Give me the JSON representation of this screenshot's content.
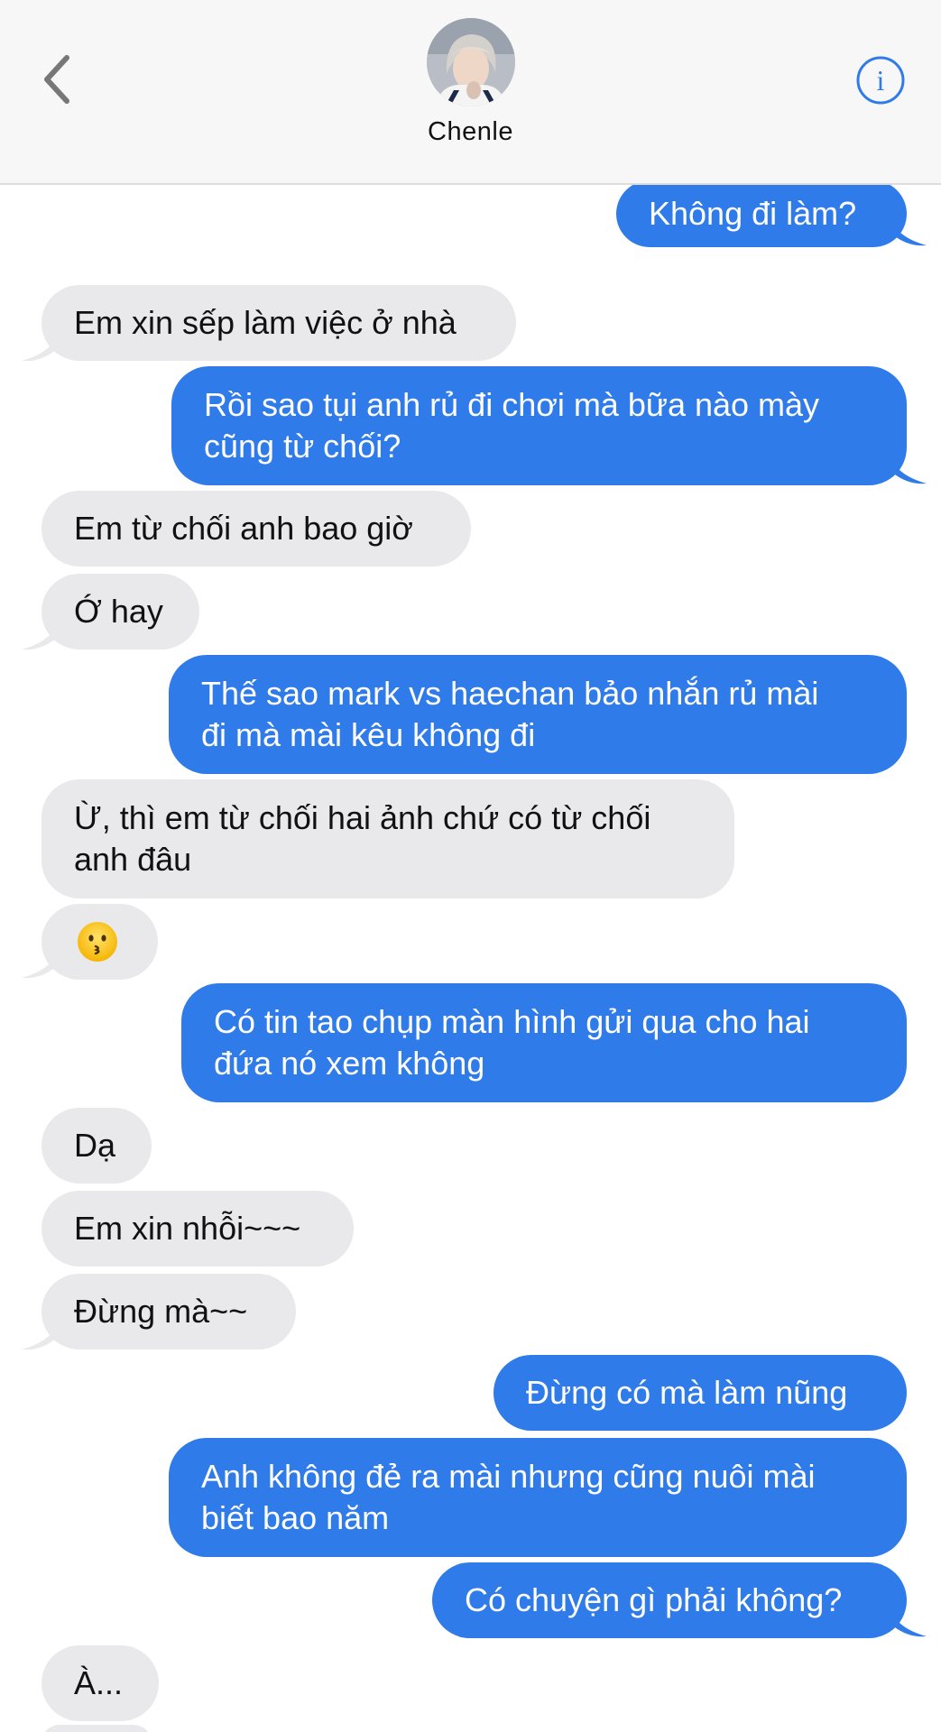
{
  "contact": {
    "name": "Chenle"
  },
  "messages": [
    {
      "side": "out",
      "text": "Không đi làm?"
    },
    {
      "side": "in",
      "text": "Em xin sếp làm việc ở nhà"
    },
    {
      "side": "out",
      "text": "Rồi sao tụi anh rủ đi chơi mà bữa nào mày\ncũng từ chối?"
    },
    {
      "side": "in",
      "text": "Em từ chối anh bao giờ"
    },
    {
      "side": "in",
      "text": "Ớ hay"
    },
    {
      "side": "out",
      "text": "Thế sao mark vs haechan bảo nhắn rủ mài\nđi mà mài kêu không đi"
    },
    {
      "side": "in",
      "text": "Ừ, thì em từ chối hai ảnh chứ có từ chối\nanh đâu"
    },
    {
      "side": "in",
      "text": "",
      "icon": "kissing-face-emoji-icon"
    },
    {
      "side": "out",
      "text": "Có tin tao chụp màn hình gửi qua cho hai\nđứa nó xem không"
    },
    {
      "side": "in",
      "text": "Dạ"
    },
    {
      "side": "in",
      "text": "Em xin nhỗi~~~"
    },
    {
      "side": "in",
      "text": "Đừng mà~~"
    },
    {
      "side": "out",
      "text": "Đừng có mà làm nũng"
    },
    {
      "side": "out",
      "text": "Anh không đẻ ra mài nhưng cũng nuôi mài\nbiết bao năm"
    },
    {
      "side": "out",
      "text": "Có chuyện gì phải không?"
    },
    {
      "side": "in",
      "text": "À..."
    }
  ],
  "icons": {
    "back": "chevron-left-icon",
    "info": "info-icon"
  },
  "colors": {
    "outgoing_bubble": "#2f7bea",
    "incoming_bubble": "#e9e9eb",
    "accent": "#2f7bea",
    "header_bg": "#f7f7f7"
  }
}
